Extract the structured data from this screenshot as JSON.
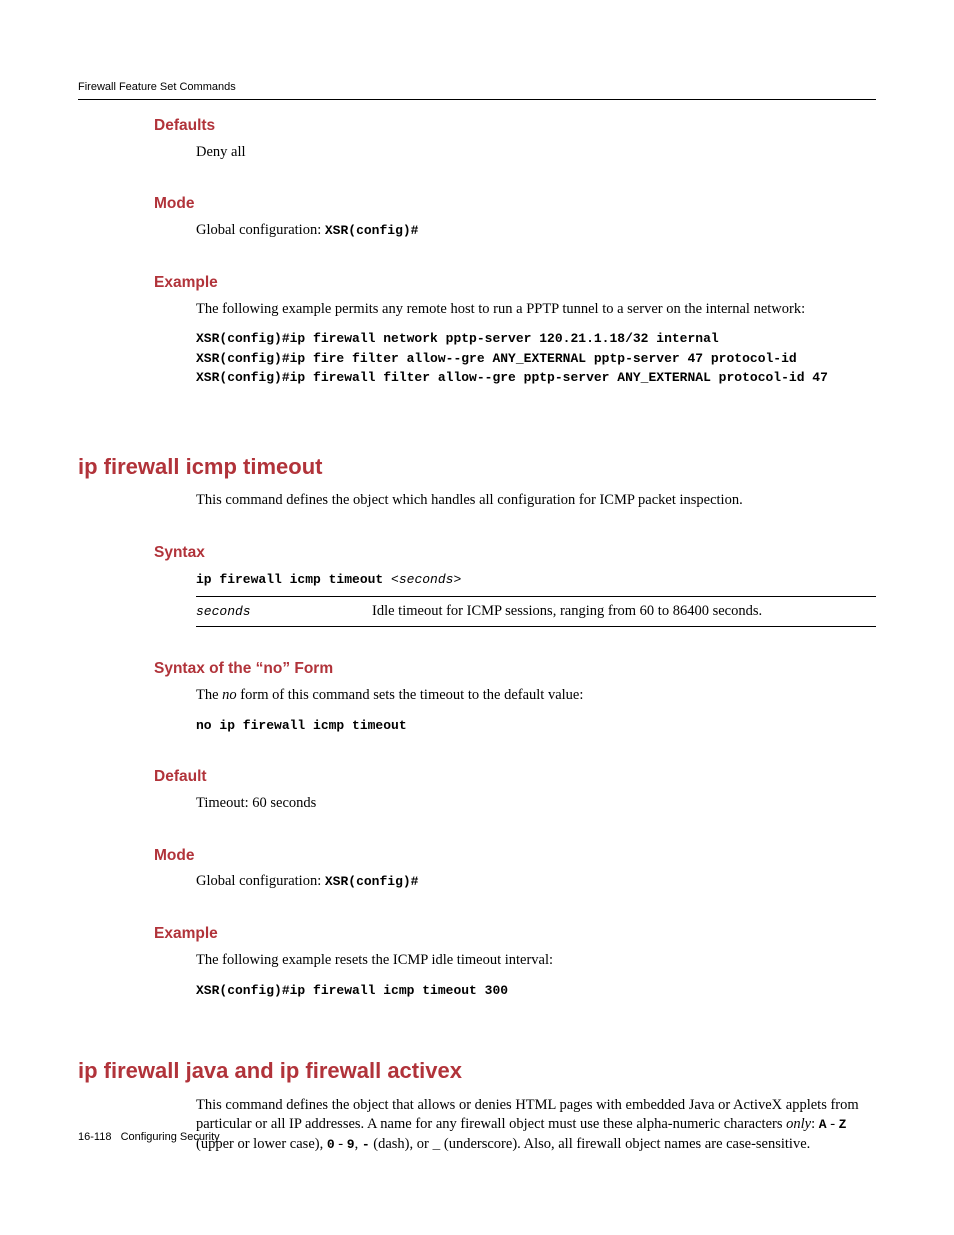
{
  "runningHead": "Firewall Feature Set Commands",
  "defaults": {
    "heading": "Defaults",
    "body": "Deny all"
  },
  "mode1": {
    "heading": "Mode",
    "bodyPrefix": "Global configuration: ",
    "prompt": "XSR(config)#"
  },
  "example1": {
    "heading": "Example",
    "intro": "The following example permits any remote host to run a PPTP tunnel to a server on the internal network:",
    "lines": [
      "XSR(config)#ip firewall network pptp-server 120.21.1.18/32 internal",
      "XSR(config)#ip fire filter allow--gre ANY_EXTERNAL pptp-server 47 protocol-id",
      "XSR(config)#ip firewall filter allow--gre pptp-server ANY_EXTERNAL protocol-id 47"
    ]
  },
  "cmd1": {
    "title": "ip firewall icmp timeout",
    "desc": "This command defines the object which handles all configuration for ICMP packet inspection.",
    "syntaxHeading": "Syntax",
    "syntaxCmd": "ip firewall icmp timeout ",
    "syntaxArg": "<seconds>",
    "paramName": "seconds",
    "paramDesc": "Idle timeout for ICMP sessions, ranging from 60 to 86400 seconds.",
    "noFormHeading": "Syntax of the “no” Form",
    "noFormIntro1": "The ",
    "noFormIntroItalic": "no",
    "noFormIntro2": " form of this command sets the timeout to the default value:",
    "noFormCmd": "no ip firewall icmp timeout",
    "defaultHeading": "Default",
    "defaultBody": "Timeout: 60 seconds",
    "mode2Heading": "Mode",
    "mode2Prefix": "Global configuration: ",
    "mode2Prompt": "XSR(config)#",
    "example2Heading": "Example",
    "example2Intro": "The following example resets the ICMP idle timeout interval:",
    "example2Cmd": "XSR(config)#ip firewall icmp timeout 300"
  },
  "cmd2": {
    "title": "ip firewall java and ip firewall activex",
    "desc1": "This command defines the object that allows or denies HTML pages with embedded Java or ActiveX applets from particular or all IP addresses. A name for any firewall object must use these alpha-numeric characters ",
    "descItalic": "only",
    "desc2": ": ",
    "bA": "A",
    "desc3": " - ",
    "bZ": "Z",
    "desc4": " (upper or lower case), ",
    "b0": "0",
    "desc5": " - ",
    "b9": "9",
    "desc6": ", ",
    "bDash": "-",
    "desc7": " (dash), or  ",
    "bUnder": "_",
    "desc8": " (underscore). Also, all firewall object names are case-sensitive."
  },
  "footer": {
    "pageNum": "16-118",
    "section": "Configuring Security"
  }
}
